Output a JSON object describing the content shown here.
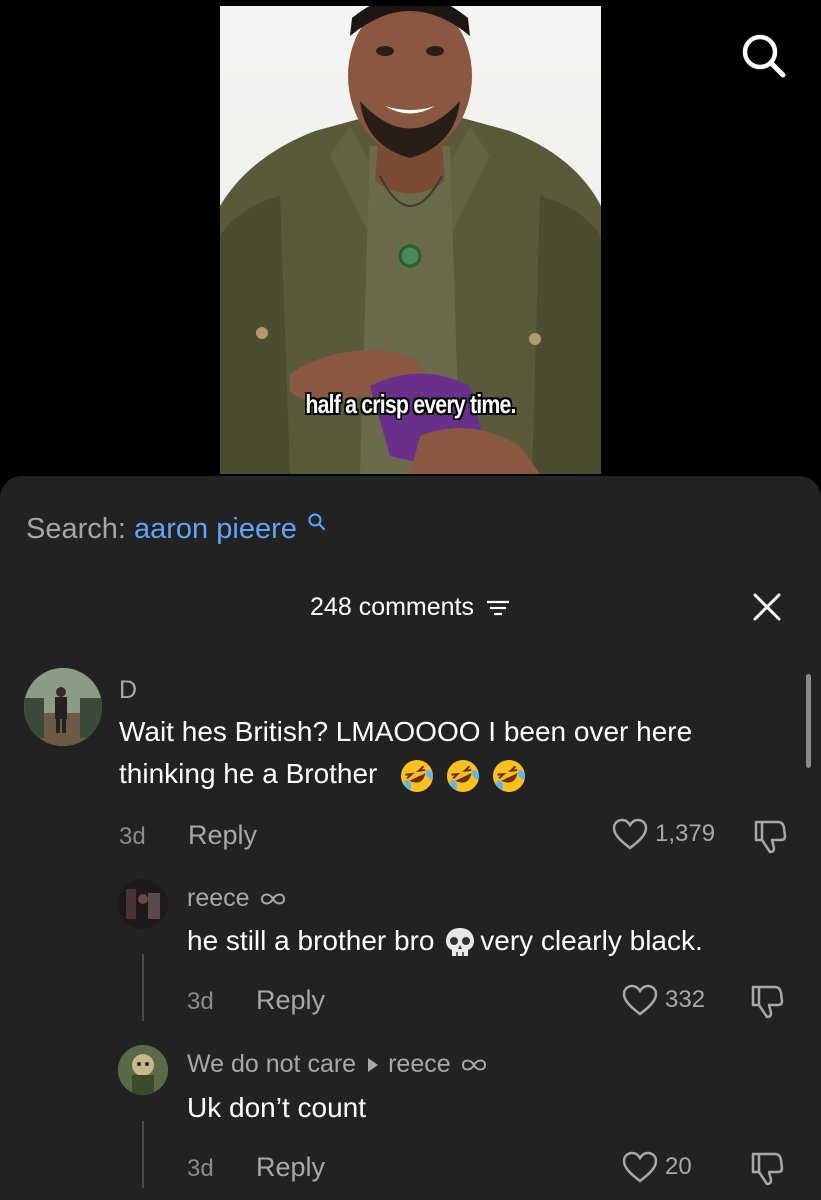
{
  "video": {
    "caption": "half a crisp every time."
  },
  "search": {
    "prefix": "Search:",
    "term": "aaron pieere"
  },
  "comments_header": {
    "count_label": "248 comments"
  },
  "comments": [
    {
      "username": "D",
      "text_line1": "Wait hes British? LMAOOOO I been over here",
      "text_line2": "thinking he a Brother",
      "emoji": [
        "rolling-on-floor-laughing",
        "rolling-on-floor-laughing",
        "rolling-on-floor-laughing"
      ],
      "time": "3d",
      "reply_label": "Reply",
      "likes": "1,379"
    },
    {
      "username": "reece",
      "text_before_emoji": "he still a brother bro",
      "emoji": "skull",
      "text_after_emoji": "very clearly black.",
      "time": "3d",
      "reply_label": "Reply",
      "likes": "332"
    },
    {
      "username": "We do not care",
      "reply_to": "reece",
      "text": "Uk don’t count",
      "time": "3d",
      "reply_label": "Reply",
      "likes": "20"
    }
  ],
  "colors": {
    "sheet_bg": "#222222",
    "link_blue": "#5fa5f7",
    "muted_text": "#a8a8a8"
  }
}
